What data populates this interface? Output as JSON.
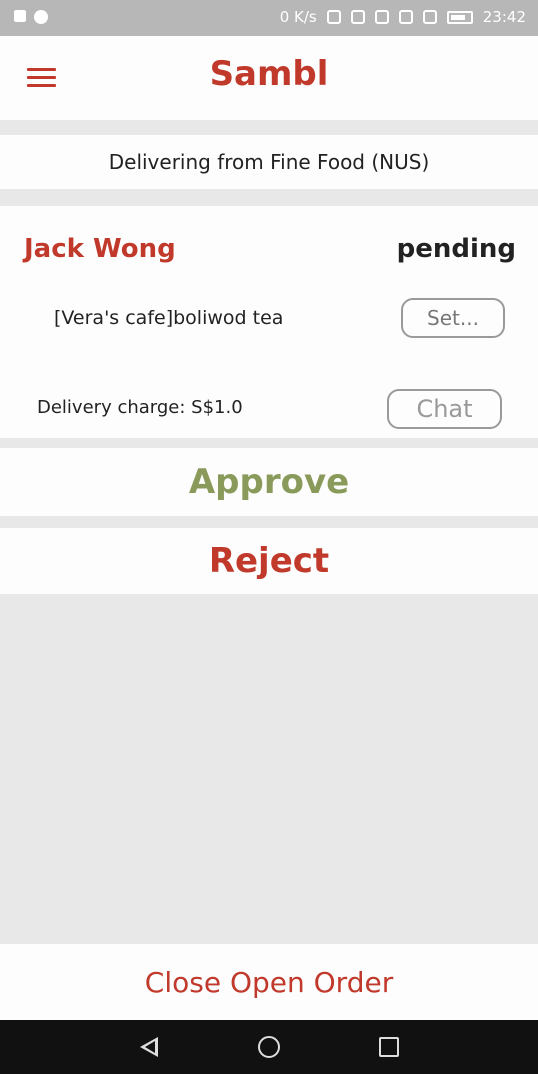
{
  "status_bar": {
    "network_speed": "0 K/s",
    "time": "23:42"
  },
  "app_bar": {
    "title": "Sambl",
    "menu_icon": "hamburger-menu-icon"
  },
  "banner": {
    "text": "Delivering from Fine Food (NUS)"
  },
  "order": {
    "customer_name": "Jack Wong",
    "status": "pending",
    "item": "[Vera's cafe]boliwod tea",
    "set_button_label": "Set...",
    "delivery_charge": "Delivery charge: S$1.0",
    "chat_button_label": "Chat"
  },
  "actions": {
    "approve_label": "Approve",
    "reject_label": "Reject"
  },
  "footer": {
    "close_order_label": "Close Open Order"
  },
  "colors": {
    "accent": "#c0392b",
    "approve": "#8a9a5b",
    "background": "#e8e8e8"
  }
}
